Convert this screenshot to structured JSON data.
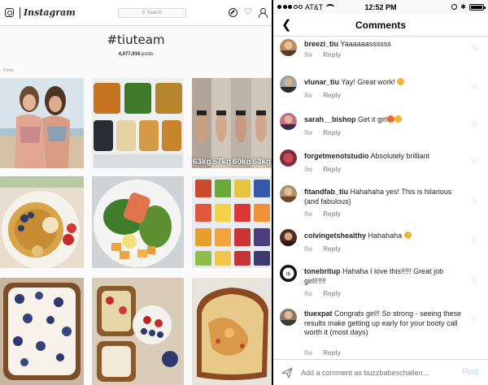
{
  "left": {
    "app_name": "Instagram",
    "search_placeholder": "Search",
    "hashtag": "#tiuteam",
    "post_count": "4,077,916",
    "post_count_suffix": "posts",
    "section_label": "Posts",
    "weight_labels": [
      "63kg",
      "57kg",
      "60kg",
      "63kg"
    ],
    "icons": [
      "instagram-logo-icon",
      "search-icon",
      "compass-icon",
      "heart-icon",
      "person-icon"
    ]
  },
  "right": {
    "status": {
      "carrier": "AT&T",
      "time": "12:52 PM",
      "battery_percent": 100
    },
    "header_title": "Comments",
    "comments": [
      {
        "user": "breezi_tiu",
        "text": "Yaaaaaassssss",
        "age": "8w",
        "reply": "Reply"
      },
      {
        "user": "vlunar_tiu",
        "text": "Yay! Great work!",
        "emoji": "flexed-biceps",
        "age": "8w",
        "reply": "Reply"
      },
      {
        "user": "sarah__bishop",
        "text": "Get it girl",
        "emoji": "fire raised-hands",
        "age": "8w",
        "reply": "Reply"
      },
      {
        "user": "forgetmenotstudio",
        "text": "Absolutely brilliant",
        "age": "8w",
        "reply": "Reply"
      },
      {
        "user": "fitandfab_tiu",
        "text": "Hahahaha yes! This is hilarious (and fabulous)",
        "age": "8w",
        "reply": "Reply"
      },
      {
        "user": "colvingetshealthy",
        "text": "Hahahaha",
        "emoji": "thumbs-up",
        "age": "8w",
        "reply": "Reply"
      },
      {
        "user": "tonebritup",
        "text": "Hahaha I love this!!!!! Great job girl!!!!!!",
        "age": "8w",
        "reply": "Reply"
      },
      {
        "user": "tiuexpat",
        "text": "Congrats girl!! So strong - seeing these results make getting up early for your booty call worth it (most days)",
        "age": "8w",
        "reply": "Reply"
      }
    ],
    "input_placeholder": "Add a comment as buzzbabeschallen...",
    "post_label": "Post",
    "colors": {
      "post_disabled": "#b3d7f5",
      "meta_gray": "#999999",
      "text": "#262626"
    }
  }
}
